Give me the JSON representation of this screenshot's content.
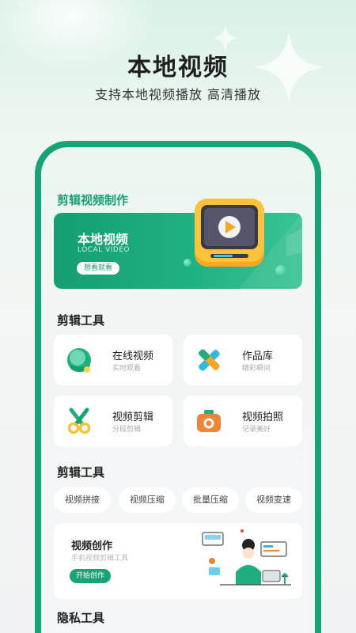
{
  "hero": {
    "title": "本地视频",
    "subtitle": "支持本地视频播放 高清播放"
  },
  "app": {
    "section_make": "剪辑视频制作",
    "banner": {
      "title": "本地视频",
      "subtitle": "LOCAL VIDEO",
      "button": "想看就看"
    },
    "section_tools": "剪辑工具",
    "tools": [
      {
        "title": "在线视频",
        "subtitle": "实时观看",
        "icon": "online-video-icon"
      },
      {
        "title": "作品库",
        "subtitle": "精彩瞬间",
        "icon": "works-library-icon"
      },
      {
        "title": "视频剪辑",
        "subtitle": "分段剪辑",
        "icon": "scissors-icon"
      },
      {
        "title": "视频拍照",
        "subtitle": "记录美好",
        "icon": "camera-icon"
      }
    ],
    "section_tools2": "剪辑工具",
    "chips": [
      "视频拼接",
      "视频压缩",
      "批量压缩",
      "视频变速"
    ],
    "create_card": {
      "title": "视频创作",
      "subtitle": "手机视频剪辑工具",
      "button": "开始创作"
    },
    "section_privacy": "隐私工具"
  },
  "colors": {
    "accent": "#15a377",
    "banner_gradient_start": "#149e73",
    "tv_orange": "#f5a623"
  }
}
